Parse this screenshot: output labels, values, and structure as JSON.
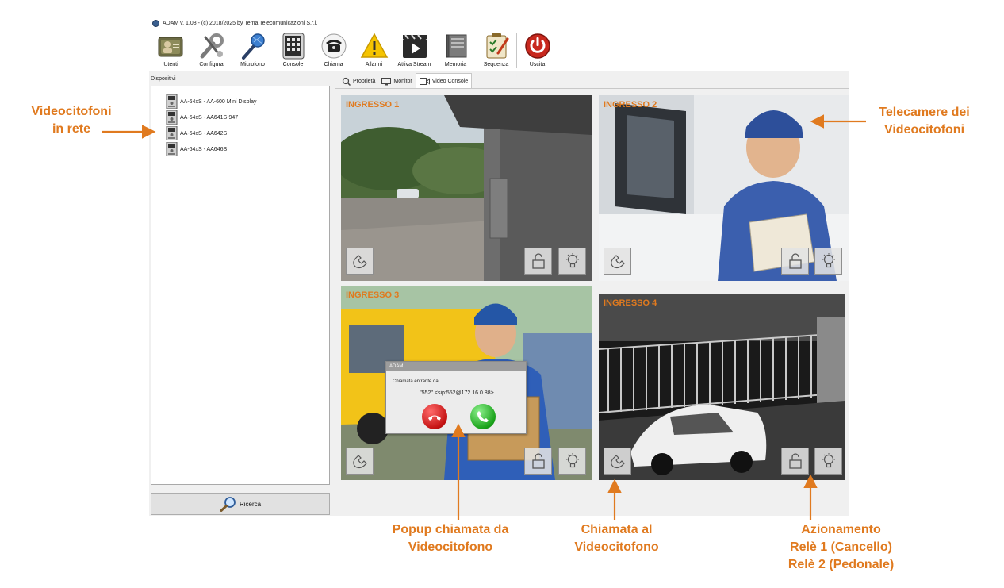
{
  "window": {
    "title": "ADAM v. 1.08 - (c) 2018/2025 by Tema Telecomunicazioni S.r.l."
  },
  "toolbar": {
    "buttons": [
      {
        "label": "Utenti",
        "icon": "users-icon"
      },
      {
        "label": "Configura",
        "icon": "wrench-icon"
      },
      {
        "label": "Microfono",
        "icon": "microphone-icon"
      },
      {
        "label": "Console",
        "icon": "keypad-icon"
      },
      {
        "label": "Chiama",
        "icon": "phone-icon"
      },
      {
        "label": "Allarmi",
        "icon": "warning-icon"
      },
      {
        "label": "Attiva Stream",
        "icon": "play-icon"
      },
      {
        "label": "Memoria",
        "icon": "memory-icon"
      },
      {
        "label": "Sequenza",
        "icon": "sequence-icon"
      },
      {
        "label": "Uscita",
        "icon": "power-icon"
      }
    ]
  },
  "devices": {
    "header": "Dispositivi",
    "items": [
      "AA-64xS - AA-600 Mini Display",
      "AA-64xS - AA641S-947",
      "AA-64xS - AA642S",
      "AA-64xS - AA646S"
    ],
    "search_label": "Ricerca"
  },
  "tabs": [
    {
      "label": "Proprietà",
      "icon": "properties-icon"
    },
    {
      "label": "Monitor",
      "icon": "monitor-icon"
    },
    {
      "label": "Video Console",
      "icon": "video-camera-icon",
      "active": true
    }
  ],
  "cameras": [
    {
      "label": "INGRESSO 1"
    },
    {
      "label": "INGRESSO 2"
    },
    {
      "label": "INGRESSO 3"
    },
    {
      "label": "INGRESSO 4"
    }
  ],
  "popup": {
    "title": "ADAM",
    "text": "Chiamata entrante da:",
    "caller": "\"552\" <sip:552@172.16.0.88>"
  },
  "annotations": {
    "network": [
      "Videocitofoni",
      "in rete"
    ],
    "cameras": [
      "Telecamere dei",
      "Videocitofoni"
    ],
    "popup": [
      "Popup chiamata da",
      "Videocitofono"
    ],
    "call": [
      "Chiamata al",
      "Videocitofono"
    ],
    "relay": [
      "Azionamento",
      "Relè 1 (Cancello)",
      "Relè 2 (Pedonale)"
    ]
  },
  "colors": {
    "annotation": "#e07a1f",
    "background": "#f0f0f0"
  }
}
